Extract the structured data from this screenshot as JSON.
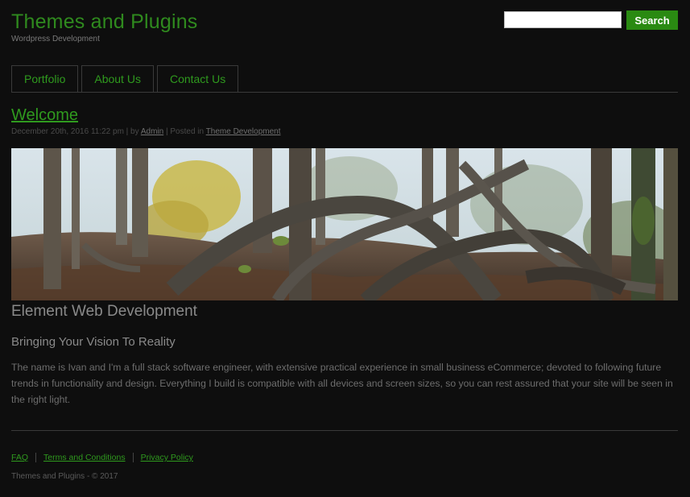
{
  "site": {
    "title": "Themes and Plugins",
    "tagline": "Wordpress Development"
  },
  "search": {
    "value": "",
    "placeholder": "",
    "button_label": "Search"
  },
  "nav": {
    "tabs": [
      "Portfolio",
      "About Us",
      "Contact Us"
    ]
  },
  "post": {
    "title": "Welcome",
    "meta_date": "December 20th, 2016 11:22 pm | by",
    "author": "Admin",
    "meta_posted": "| Posted in",
    "category": "Theme Development",
    "heading": "Element Web Development",
    "subheading": "Bringing Your Vision To Reality",
    "body": "The name is Ivan and I'm a full stack software engineer, with extensive practical experience in small business eCommerce; devoted to following future trends in functionality and design. Everything I build is compatible with all devices and screen sizes, so you can rest assured that your site will be seen in the right light."
  },
  "footer": {
    "links": [
      "FAQ",
      "Terms and Conditions",
      "Privacy Policy"
    ],
    "copyright": "Themes and Plugins - © 2017"
  },
  "colors": {
    "background": "#0e0e0e",
    "accent": "#2f9a1e",
    "button": "#2a8a12"
  }
}
